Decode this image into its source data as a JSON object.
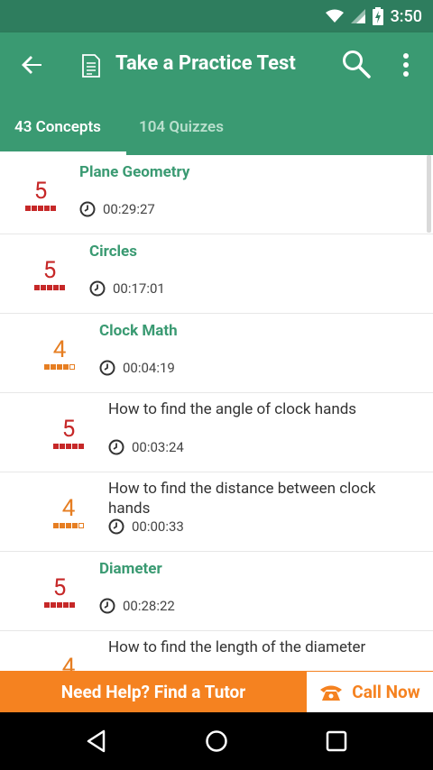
{
  "status_bar": {
    "time": "3:50"
  },
  "app_bar": {
    "title": "Take a Practice Test"
  },
  "tabs": [
    {
      "label": "43 Concepts",
      "active": true
    },
    {
      "label": "104 Quizzes",
      "active": false
    }
  ],
  "items": [
    {
      "score": "5",
      "score_color": "red",
      "filled": 5,
      "title": "Plane Geometry",
      "type": "concept",
      "time": "00:29:27"
    },
    {
      "score": "5",
      "score_color": "red",
      "filled": 5,
      "title": "Circles",
      "type": "concept",
      "time": "00:17:01"
    },
    {
      "score": "4",
      "score_color": "orange",
      "filled": 4,
      "title": "Clock Math",
      "type": "concept",
      "time": "00:04:19"
    },
    {
      "score": "5",
      "score_color": "red",
      "filled": 5,
      "title": "How to find the angle of clock hands",
      "type": "sub",
      "time": "00:03:24"
    },
    {
      "score": "4",
      "score_color": "orange",
      "filled": 4,
      "title": "How to find the distance between clock hands",
      "type": "sub",
      "time": "00:00:33"
    },
    {
      "score": "5",
      "score_color": "red",
      "filled": 5,
      "title": "Diameter",
      "type": "concept",
      "time": "00:28:22"
    },
    {
      "score": "4",
      "score_color": "orange",
      "filled": 4,
      "title": "How to find the length of the diameter",
      "type": "sub",
      "time": ""
    }
  ],
  "banner": {
    "help_label": "Need Help? Find a Tutor",
    "call_label": "Call Now"
  },
  "colors": {
    "primary": "#3a9a72",
    "status_bar": "#2e7d5e",
    "accent_orange": "#f58220",
    "score_red": "#c62828",
    "score_orange": "#e67e22"
  }
}
